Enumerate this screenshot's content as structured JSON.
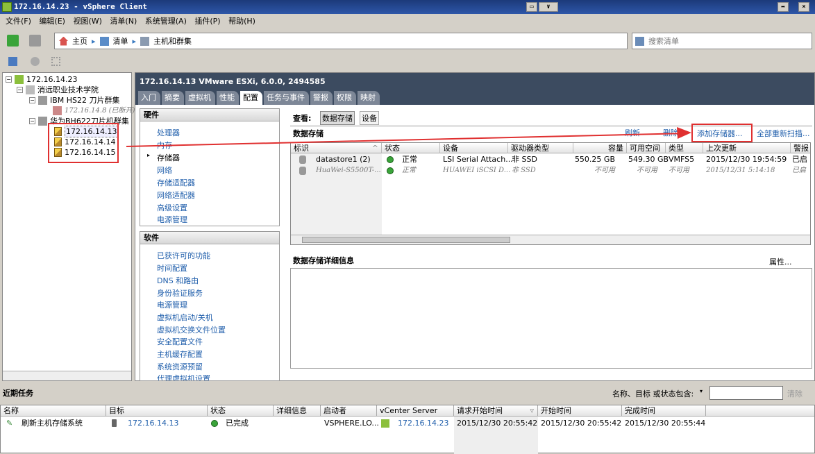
{
  "window": {
    "title": "172.16.14.23 - vSphere Client"
  },
  "menu": [
    "文件(F)",
    "编辑(E)",
    "视图(W)",
    "清单(N)",
    "系统管理(A)",
    "插件(P)",
    "帮助(H)"
  ],
  "breadcrumb": [
    "主页",
    "清单",
    "主机和群集"
  ],
  "search": {
    "placeholder": "搜索清单"
  },
  "tree": {
    "root": "172.16.14.23",
    "datacenter": "消远职业技术学院",
    "cluster1": "IBM HS22 刀片群集",
    "host_disconnected": "172.16.14.8 (已断开)",
    "cluster2": "华为BH622刀片机群集",
    "hosts": [
      "172.16.14.13",
      "172.16.14.14",
      "172.16.14.15"
    ]
  },
  "host_header": "172.16.14.13 VMware ESXi, 6.0.0, 2494585",
  "tabs": [
    "入门",
    "摘要",
    "虚拟机",
    "性能",
    "配置",
    "任务与事件",
    "警报",
    "权限",
    "映射"
  ],
  "active_tab": "配置",
  "hardware": {
    "title": "硬件",
    "items": [
      "处理器",
      "内存",
      "存储器",
      "网络",
      "存储适配器",
      "网络适配器",
      "高级设置",
      "电源管理"
    ],
    "selected": "存储器"
  },
  "software": {
    "title": "软件",
    "items": [
      "已获许可的功能",
      "时间配置",
      "DNS 和路由",
      "身份验证服务",
      "电源管理",
      "虚拟机启动/关机",
      "虚拟机交换文件位置",
      "安全配置文件",
      "主机缓存配置",
      "系统资源预留",
      "代理虚拟机设置"
    ]
  },
  "view": {
    "label": "查看:",
    "options": [
      "数据存储",
      "设备"
    ],
    "selected": "数据存储"
  },
  "datastores": {
    "title": "数据存储",
    "actions": [
      "刷新",
      "删除",
      "添加存储器...",
      "全部重新扫描..."
    ],
    "columns": [
      "标识",
      "状态",
      "设备",
      "驱动器类型",
      "容量",
      "可用空间",
      "类型",
      "上次更新",
      "警报"
    ],
    "rows": [
      {
        "id": "datastore1 (2)",
        "status": "正常",
        "device": "LSI Serial Attach...",
        "drive": "非 SSD",
        "capacity": "550.25 GB",
        "free": "549.30 GB",
        "type": "VMFS5",
        "updated": "2015/12/30 19:54:59",
        "alarm": "已启"
      },
      {
        "id": "HuaWei-S5500T-...",
        "status": "正常",
        "device": "HUAWEI iSCSI D...",
        "drive": "非 SSD",
        "capacity": "不可用",
        "free": "不可用",
        "type": "不可用",
        "updated": "2015/12/31 5:14:18",
        "alarm": "已启"
      }
    ]
  },
  "details": {
    "title": "数据存储详细信息",
    "properties": "属性..."
  },
  "recent_tasks": {
    "title": "近期任务",
    "filter_label": "名称、目标 或状态包含:",
    "clear": "清除",
    "columns": [
      "名称",
      "目标",
      "状态",
      "详细信息",
      "启动者",
      "vCenter Server",
      "请求开始时间",
      "开始时间",
      "完成时间"
    ],
    "rows": [
      {
        "name": "刷新主机存储系统",
        "target": "172.16.14.13",
        "status": "已完成",
        "details": "",
        "initiator": "VSPHERE.LO...",
        "vcenter": "172.16.14.23",
        "requested": "2015/12/30 20:55:42",
        "start": "2015/12/30 20:55:42",
        "end": "2015/12/30 20:55:44"
      }
    ]
  },
  "colors": {
    "annotation": "#e03030",
    "link": "#1f5eab",
    "header": "#3c4b60"
  }
}
